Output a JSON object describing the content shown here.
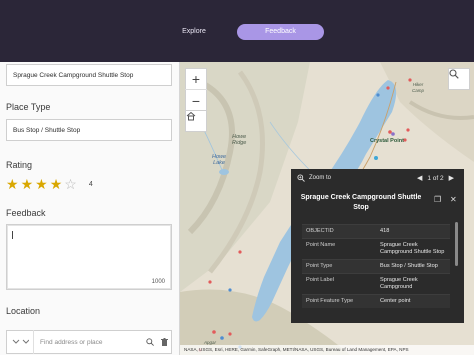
{
  "header": {
    "tabs": [
      {
        "label": "Explore",
        "active": false
      },
      {
        "label": "Feedback",
        "active": true
      }
    ],
    "colors": {
      "bar": "#2b2638",
      "active_tab": "#a996e6"
    }
  },
  "form": {
    "name_value": "Sprague Creek Campground Shuttle Stop",
    "place_type": {
      "label": "Place Type",
      "value": "Bus Stop / Shuttle Stop"
    },
    "rating": {
      "label": "Rating",
      "value": 4,
      "max": 5
    },
    "feedback": {
      "label": "Feedback",
      "value": "",
      "char_count": "1000"
    },
    "location": {
      "label": "Location",
      "placeholder": "Find address or place"
    }
  },
  "map": {
    "labels": {
      "howe_ridge": "Howe\nRidge",
      "howe_lake": "Howe\nLake",
      "crystal_point": "Crystal Point",
      "hiker": "Hiker\nCamp",
      "apgar": "Apgar"
    },
    "attribution": "NASA, USGS, Esri, HERE, Garmin, SafeGraph, METI/NASA, USGS, Bureau of Land Management, EPA, NPS"
  },
  "popup": {
    "zoom_to": "Zoom to",
    "pager": "1 of 2",
    "title": "Sprague Creek Campground Shuttle Stop",
    "attributes": [
      {
        "key": "OBJECTID",
        "value": "418"
      },
      {
        "key": "Point Name",
        "value": "Sprague Creek Campground Shuttle Stop"
      },
      {
        "key": "Point Type",
        "value": "Bus Stop / Shuttle Stop"
      },
      {
        "key": "Point Label",
        "value": "Sprague Creek Campground"
      },
      {
        "key": "Point Feature Type",
        "value": "Center point"
      }
    ]
  }
}
